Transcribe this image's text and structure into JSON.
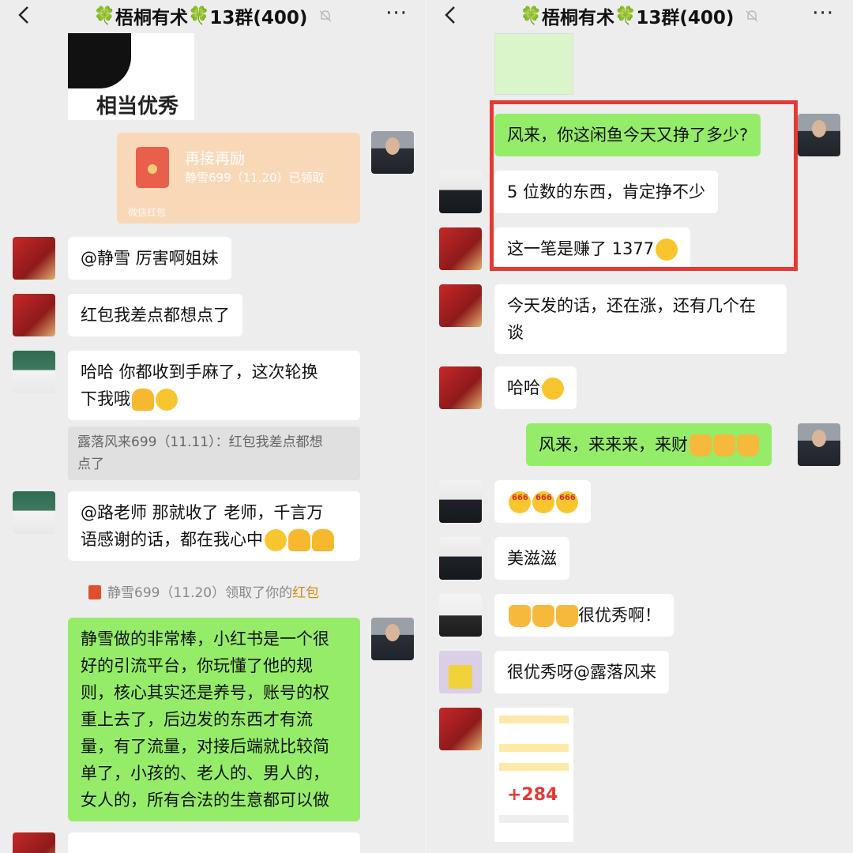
{
  "header": {
    "title_prefix": "🍀",
    "title_main": "梧桐有术",
    "title_mid": "🍀",
    "title_group": "13群(400)",
    "more": "···"
  },
  "left": {
    "sticker_text": "相当优秀",
    "redpacket": {
      "title": "再接再励",
      "subtitle": "静雪699（11.20）已领取",
      "footer": "微信红包"
    },
    "messages": [
      {
        "text": "@静雪  厉害啊姐妹"
      },
      {
        "text": "红包我差点都想点了"
      },
      {
        "line1": "哈哈  你都收到手麻了，这次轮换",
        "line2": "下我哦"
      },
      {
        "line1": "@路老师  那就收了  老师，千言万",
        "line2": "语感谢的话，都在我心中"
      }
    ],
    "quote": {
      "line1": "露落风来699（11.11）：红包我差点都想",
      "line2": "点了"
    },
    "system": {
      "text": "静雪699（11.20）领取了你的",
      "link": "红包"
    },
    "long_message": [
      "静雪做的非常棒，小红书是一个很",
      "好的引流平台，你玩懂了他的规",
      "则，核心其实还是养号，账号的权",
      "重上去了，后边发的东西才有流",
      "量，有了流量，对接后端就比较简",
      "单了，小孩的、老人的、男人的，",
      "女人的，所有合法的生意都可以做"
    ]
  },
  "right": {
    "messages": [
      {
        "text": "风来，你这闲鱼今天又挣了多少?"
      },
      {
        "text": "5 位数的东西，肯定挣不少"
      },
      {
        "text": "这一笔是赚了 1377"
      },
      {
        "line1": "今天发的话，还在涨，还有几个在",
        "line2": "谈"
      },
      {
        "text": "哈哈"
      },
      {
        "text": "风来，来来来，来财"
      },
      {
        "text": ""
      },
      {
        "text": "美滋滋"
      },
      {
        "text": "很优秀啊！"
      },
      {
        "text": "很优秀呀@露落风来"
      }
    ],
    "order_number": "+284"
  }
}
